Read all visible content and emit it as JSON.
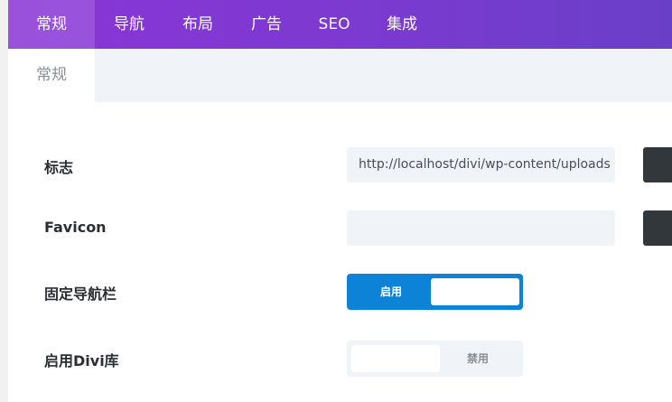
{
  "topnav": {
    "tabs": [
      {
        "label": "常规",
        "active": true
      },
      {
        "label": "导航",
        "active": false
      },
      {
        "label": "布局",
        "active": false
      },
      {
        "label": "广告",
        "active": false
      },
      {
        "label": "SEO",
        "active": false
      },
      {
        "label": "集成",
        "active": false
      }
    ]
  },
  "subnav": {
    "tabs": [
      {
        "label": "常规",
        "active": true
      }
    ]
  },
  "settings": {
    "logo": {
      "label": "标志",
      "value": "http://localhost/divi/wp-content/uploads"
    },
    "favicon": {
      "label": "Favicon",
      "value": ""
    },
    "fixed_nav": {
      "label": "固定导航栏",
      "state_label": "启用",
      "enabled": true
    },
    "divi_library": {
      "label": "启用Divi库",
      "state_label": "禁用",
      "enabled": false
    }
  },
  "colors": {
    "accent_purple": "#8a35d6",
    "toggle_on_blue": "#0c83d6",
    "upload_button": "#32373c"
  }
}
